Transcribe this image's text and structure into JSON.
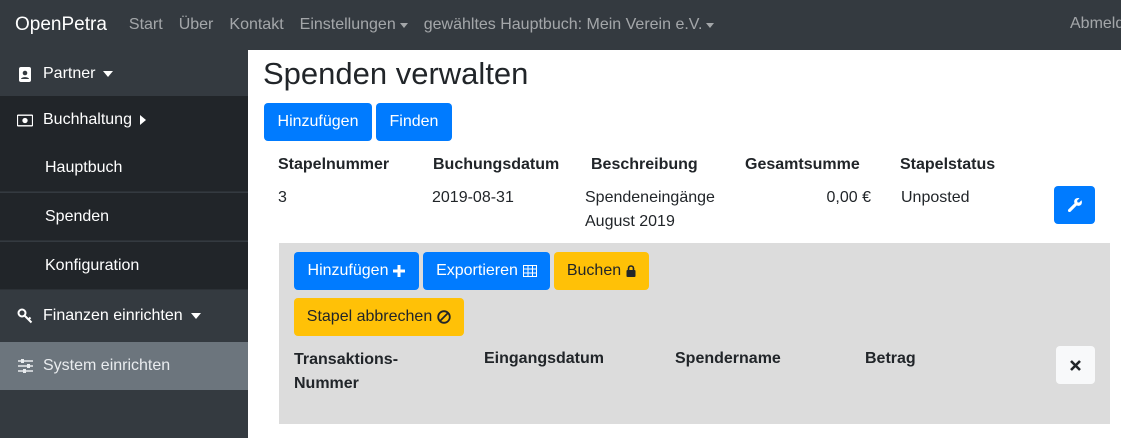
{
  "navbar": {
    "brand": "OpenPetra",
    "links": [
      "Start",
      "Über",
      "Kontakt"
    ],
    "settings": "Einstellungen",
    "ledger": "gewähltes Hauptbuch: Mein Verein e.V.",
    "logout": "Abmelden"
  },
  "sidebar": {
    "partner": "Partner",
    "accounting": "Buchhaltung",
    "ledger": "Hauptbuch",
    "donations": "Spenden",
    "configuration": "Konfiguration",
    "finance_setup": "Finanzen einrichten",
    "system_setup": "System einrichten"
  },
  "main": {
    "title": "Spenden verwalten",
    "add_label": "Hinzufügen",
    "find_label": "Finden",
    "columns": [
      "Stapelnummer",
      "Buchungsdatum",
      "Beschreibung",
      "Gesamtsumme",
      "Stapelstatus"
    ],
    "batch": {
      "number": "3",
      "date": "2019-08-31",
      "description_line1": "Spendeneingänge",
      "description_line2": "August 2019",
      "total": "0,00 €",
      "status": "Unposted"
    }
  },
  "detail": {
    "add_label": "Hinzufügen",
    "export_label": "Exportieren",
    "post_label": "Buchen",
    "cancel_label": "Stapel abbrechen",
    "columns": {
      "transaction_line1": "Transaktions-",
      "transaction_line2": "Nummer",
      "receipt_date": "Eingangsdatum",
      "donor_name": "Spendername",
      "amount": "Betrag"
    }
  },
  "colors": {
    "navbar": "#343a40",
    "primary": "#007bff",
    "warning": "#ffc107",
    "panel": "#dcdcdc"
  },
  "icons": [
    "address-card-icon",
    "money-icon",
    "key-icon",
    "sliders-icon",
    "wrench-icon",
    "plus-icon",
    "table-icon",
    "lock-icon",
    "ban-icon",
    "close-icon"
  ]
}
